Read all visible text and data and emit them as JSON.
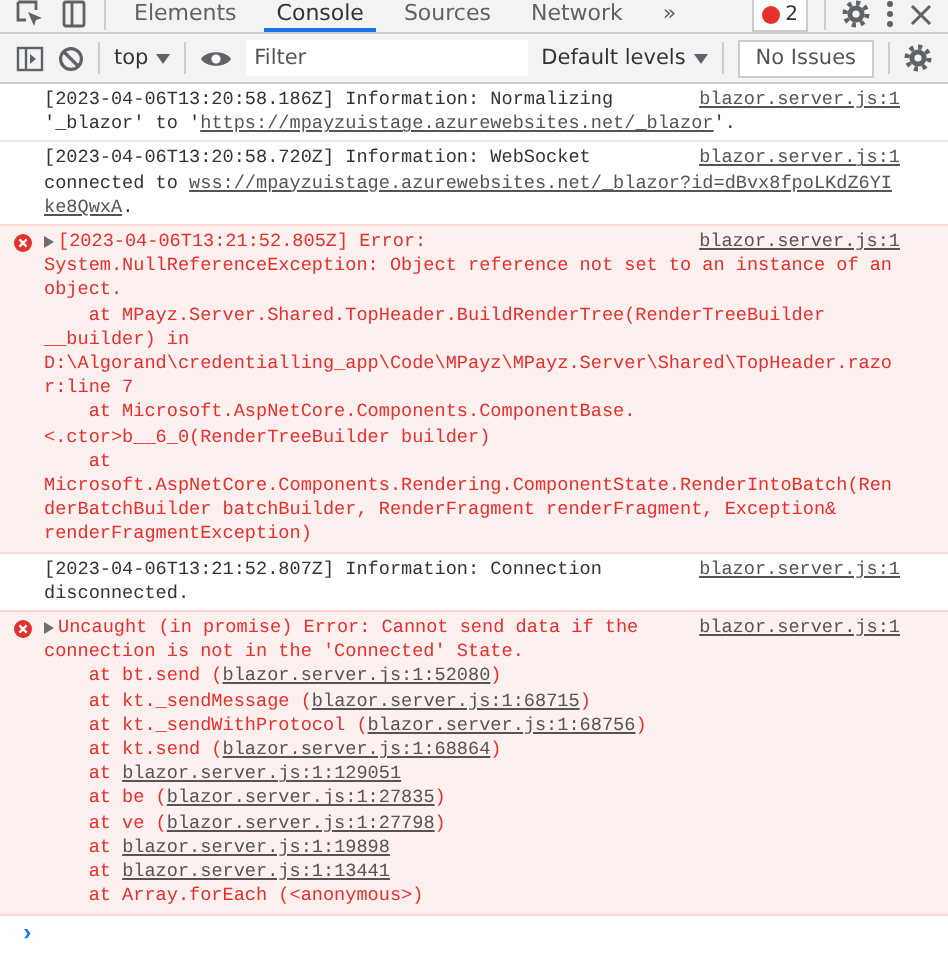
{
  "tabs": [
    {
      "label": "Elements",
      "selected": false
    },
    {
      "label": "Console",
      "selected": true
    },
    {
      "label": "Sources",
      "selected": false
    },
    {
      "label": "Network",
      "selected": false
    }
  ],
  "more_tabs": "»",
  "error_count": "2",
  "toolbar": {
    "context": "top",
    "filter": {
      "placeholder": "Filter"
    },
    "levels": "Default levels",
    "issues": "No Issues"
  },
  "messages": [
    {
      "kind": "info",
      "source": "blazor.server.js:1",
      "lines": [
        {
          "indent": false,
          "parts": [
            {
              "text": "[2023-04-06T13:20:58.186Z] Information: Normalizing",
              "link": false
            }
          ]
        },
        {
          "indent": false,
          "parts": [
            {
              "text": "'_blazor' to '",
              "link": false
            },
            {
              "text": "https://mpayzuistage.azurewebsites.net/_blazor",
              "link": true
            },
            {
              "text": "'.",
              "link": false
            }
          ]
        }
      ]
    },
    {
      "kind": "info",
      "source": "blazor.server.js:1",
      "lines": [
        {
          "indent": false,
          "parts": [
            {
              "text": "[2023-04-06T13:20:58.720Z] Information: WebSocket",
              "link": false
            }
          ]
        },
        {
          "indent": false,
          "parts": [
            {
              "text": "connected to ",
              "link": false
            },
            {
              "text": "wss://mpayzuistage.azurewebsites.net/_blazor?id=dBvx8fpoLKdZ6YI",
              "link": true
            }
          ]
        },
        {
          "indent": false,
          "parts": [
            {
              "text": "ke8QwxA",
              "link": true
            },
            {
              "text": ".",
              "link": false
            }
          ]
        }
      ]
    },
    {
      "kind": "error",
      "source": "blazor.server.js:1",
      "lines": [
        {
          "indent": false,
          "parts": [
            {
              "text": "[2023-04-06T13:21:52.805Z] Error:",
              "link": false
            }
          ]
        },
        {
          "indent": false,
          "parts": [
            {
              "text": "System.NullReferenceException: Object reference not set to an instance of an",
              "link": false
            }
          ]
        },
        {
          "indent": false,
          "parts": [
            {
              "text": "object.",
              "link": false
            }
          ]
        },
        {
          "indent": true,
          "parts": [
            {
              "text": "at MPayz.Server.Shared.TopHeader.BuildRenderTree(RenderTreeBuilder",
              "link": false
            }
          ]
        },
        {
          "indent": false,
          "parts": [
            {
              "text": "__builder) in",
              "link": false
            }
          ]
        },
        {
          "indent": false,
          "parts": [
            {
              "text": "D:\\Algorand\\credentialling_app\\Code\\MPayz\\MPayz.Server\\Shared\\TopHeader.razo",
              "link": false
            }
          ]
        },
        {
          "indent": false,
          "parts": [
            {
              "text": "r:line 7",
              "link": false
            }
          ]
        },
        {
          "indent": true,
          "parts": [
            {
              "text": "at Microsoft.AspNetCore.Components.ComponentBase.",
              "link": false
            }
          ]
        },
        {
          "indent": false,
          "parts": [
            {
              "text": "<.ctor>b__6_0(RenderTreeBuilder builder)",
              "link": false
            }
          ]
        },
        {
          "indent": true,
          "parts": [
            {
              "text": "at",
              "link": false
            }
          ]
        },
        {
          "indent": false,
          "parts": [
            {
              "text": "Microsoft.AspNetCore.Components.Rendering.ComponentState.RenderIntoBatch(Ren",
              "link": false
            }
          ]
        },
        {
          "indent": false,
          "parts": [
            {
              "text": "derBatchBuilder batchBuilder, RenderFragment renderFragment, Exception&",
              "link": false
            }
          ]
        },
        {
          "indent": false,
          "parts": [
            {
              "text": "renderFragmentException)",
              "link": false
            }
          ]
        }
      ]
    },
    {
      "kind": "info",
      "source": "blazor.server.js:1",
      "lines": [
        {
          "indent": false,
          "parts": [
            {
              "text": "[2023-04-06T13:21:52.807Z] Information: Connection",
              "link": false
            }
          ]
        },
        {
          "indent": false,
          "parts": [
            {
              "text": "disconnected.",
              "link": false
            }
          ]
        }
      ]
    },
    {
      "kind": "error",
      "source": "blazor.server.js:1",
      "lines": [
        {
          "indent": false,
          "parts": [
            {
              "text": "Uncaught (in promise) Error: Cannot send data if the",
              "link": false
            }
          ]
        },
        {
          "indent": false,
          "parts": [
            {
              "text": "connection is not in the 'Connected' State.",
              "link": false
            }
          ]
        },
        {
          "indent": true,
          "parts": [
            {
              "text": "at bt.send (",
              "link": false
            },
            {
              "text": "blazor.server.js:1:52080",
              "link": true
            },
            {
              "text": ")",
              "link": false
            }
          ]
        },
        {
          "indent": true,
          "parts": [
            {
              "text": "at kt._sendMessage (",
              "link": false
            },
            {
              "text": "blazor.server.js:1:68715",
              "link": true
            },
            {
              "text": ")",
              "link": false
            }
          ]
        },
        {
          "indent": true,
          "parts": [
            {
              "text": "at kt._sendWithProtocol (",
              "link": false
            },
            {
              "text": "blazor.server.js:1:68756",
              "link": true
            },
            {
              "text": ")",
              "link": false
            }
          ]
        },
        {
          "indent": true,
          "parts": [
            {
              "text": "at kt.send (",
              "link": false
            },
            {
              "text": "blazor.server.js:1:68864",
              "link": true
            },
            {
              "text": ")",
              "link": false
            }
          ]
        },
        {
          "indent": true,
          "parts": [
            {
              "text": "at ",
              "link": false
            },
            {
              "text": "blazor.server.js:1:129051",
              "link": true
            }
          ]
        },
        {
          "indent": true,
          "parts": [
            {
              "text": "at be (",
              "link": false
            },
            {
              "text": "blazor.server.js:1:27835",
              "link": true
            },
            {
              "text": ")",
              "link": false
            }
          ]
        },
        {
          "indent": true,
          "parts": [
            {
              "text": "at ve (",
              "link": false
            },
            {
              "text": "blazor.server.js:1:27798",
              "link": true
            },
            {
              "text": ")",
              "link": false
            }
          ]
        },
        {
          "indent": true,
          "parts": [
            {
              "text": "at ",
              "link": false
            },
            {
              "text": "blazor.server.js:1:19898",
              "link": true
            }
          ]
        },
        {
          "indent": true,
          "parts": [
            {
              "text": "at ",
              "link": false
            },
            {
              "text": "blazor.server.js:1:13441",
              "link": true
            }
          ]
        },
        {
          "indent": true,
          "parts": [
            {
              "text": "at Array.forEach (<anonymous>)",
              "link": false
            }
          ]
        }
      ]
    }
  ],
  "prompt": "›"
}
